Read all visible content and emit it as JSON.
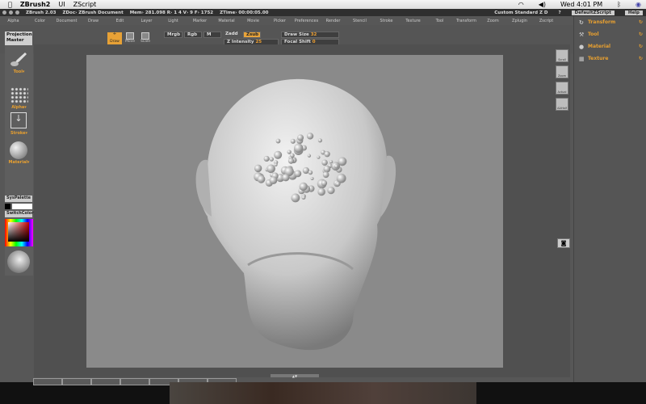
{
  "menubar": {
    "app": "ZBrush2",
    "items": [
      "UI",
      "ZScript"
    ],
    "clock": "Wed 4:01 PM"
  },
  "titlebar": {
    "app": "ZBrush 2.03",
    "doc": "ZDoc› ZBrush Document",
    "stats": "Mem› 281.098  R› 1 4  V› 9  F› 1752",
    "time": "ZTime› 00:00:05.00",
    "layout": "Custom  Standard  Z  D",
    "help_q": "?",
    "script_btn": "DefaultZScript",
    "help_btn": "Help"
  },
  "menus": [
    "Alpha",
    "Color",
    "Document",
    "Draw",
    "Edit",
    "Layer",
    "Light",
    "Marker",
    "Material",
    "Movie",
    "Picker",
    "Preferences",
    "Render",
    "Stencil",
    "Stroke",
    "Texture",
    "Tool",
    "Transform",
    "Zoom",
    "Zplugin",
    "Zscript"
  ],
  "toolbar": {
    "projection_master": "Projection Master",
    "draw": "Draw",
    "move": "Move",
    "scale": "Scale",
    "mrgb": "Mrgb",
    "rgb": "Rgb",
    "m": "M",
    "zadd": "Zadd",
    "zsub": "Zsub",
    "draw_size_label": "Draw Size",
    "draw_size": "32",
    "z_intensity_label": "Z Intensity",
    "z_intensity": "25",
    "focal_shift_label": "Focal Shift",
    "focal_shift": "0"
  },
  "leftshelf": {
    "tool": "Tool▾",
    "alpha": "Alpha▾",
    "stroke": "Stroke▾",
    "material": "Material▾",
    "syspalette": "SysPalette",
    "switchcolor": "SwitchColor"
  },
  "rightshelf": [
    "Scroll",
    "Zoom",
    "Actual",
    "AAHalf"
  ],
  "rpanel": [
    {
      "label": "Transform",
      "icon": "↻"
    },
    {
      "label": "Tool",
      "icon": "⚒"
    },
    {
      "label": "Material",
      "icon": "●"
    },
    {
      "label": "Texture",
      "icon": "▦"
    }
  ]
}
